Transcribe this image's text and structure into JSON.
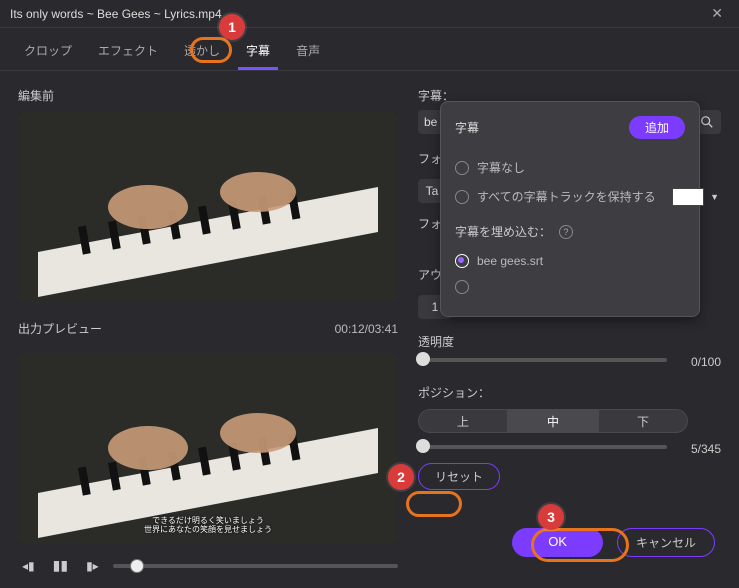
{
  "window": {
    "title": "Its only words ~ Bee Gees ~ Lyrics.mp4"
  },
  "tabs": {
    "crop": "クロップ",
    "effect": "エフェクト",
    "watermark": "透かし",
    "subtitle": "字幕",
    "audio": "音声"
  },
  "labels": {
    "before_edit": "編集前",
    "output_preview": "出力プレビュー",
    "subtitle_section": "字幕：",
    "font_prefix": "フォ",
    "font_value": "Ta",
    "size_prefix": "フォ",
    "outline_prefix": "アウ",
    "size_value": "1",
    "opacity": "透明度",
    "position": "ポジション：",
    "subtitle_snippet": "be"
  },
  "time": {
    "display": "00:12/03:41"
  },
  "popover": {
    "title": "字幕",
    "add": "追加",
    "none": "字幕なし",
    "keep_all": "すべての字幕トラックを保持する",
    "embed_label": "字幕を埋め込む：",
    "file": "bee gees.srt"
  },
  "opacity": {
    "value": "0/100"
  },
  "position": {
    "top": "上",
    "mid": "中",
    "bottom": "下",
    "value": "5/345"
  },
  "buttons": {
    "reset": "リセット",
    "ok": "OK",
    "cancel": "キャンセル"
  },
  "annotations": {
    "n1": "1",
    "n2": "2",
    "n3": "3"
  },
  "subtitle_lines": {
    "l1": "できるだけ明るく笑いましょう",
    "l2": "世界にあなたの笑顔を見せましょう"
  }
}
